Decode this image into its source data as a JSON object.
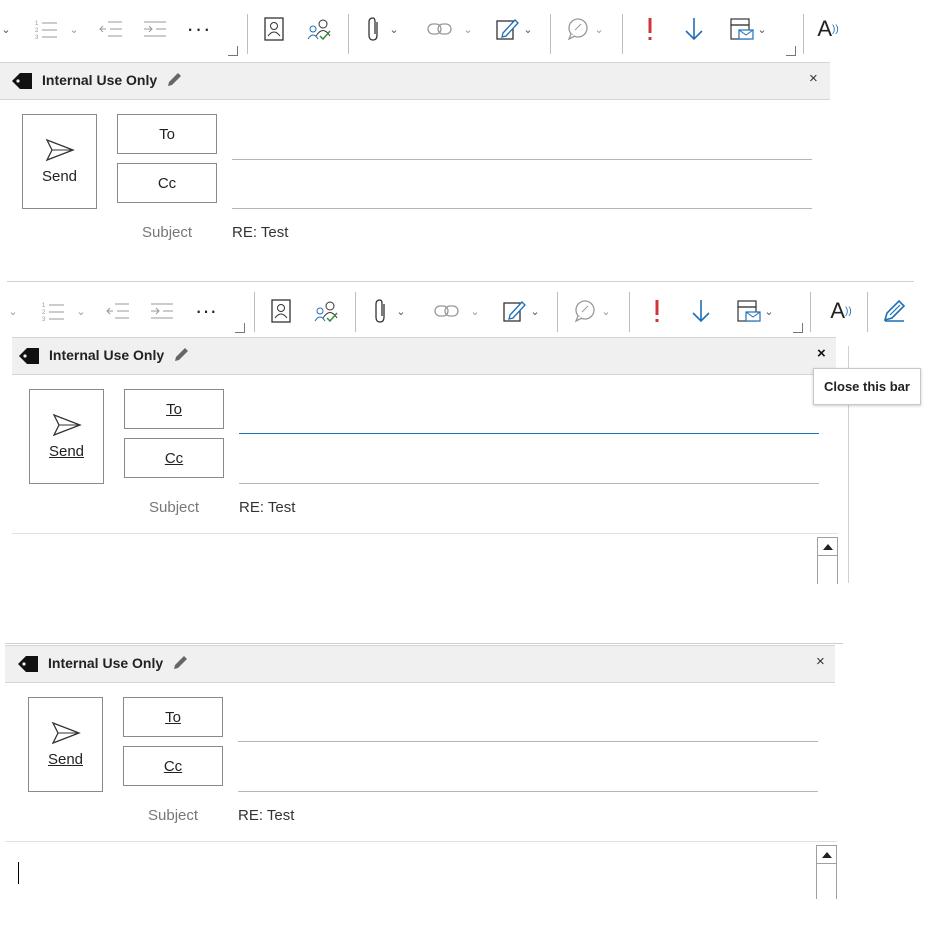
{
  "toolbar": {
    "items": [
      "numbered-list",
      "decrease-indent",
      "increase-indent",
      "more",
      "address-book",
      "check-names",
      "attach-file",
      "link",
      "signature",
      "dictate",
      "high-importance",
      "low-importance",
      "templates",
      "read-aloud",
      "editor"
    ]
  },
  "infobar": {
    "label": "Internal Use Only",
    "close_symbol": "×"
  },
  "compose": {
    "send_label": "Send",
    "to_label": "To",
    "cc_label": "Cc",
    "subject_label": "Subject",
    "subject_value": "RE: Test"
  },
  "tooltip": {
    "text": "Close this bar"
  },
  "colors": {
    "importance_red": "#d13438",
    "low_importance_blue": "#1f6fb7",
    "check_green": "#3a8d3a",
    "active_line": "#1f6fb7"
  }
}
